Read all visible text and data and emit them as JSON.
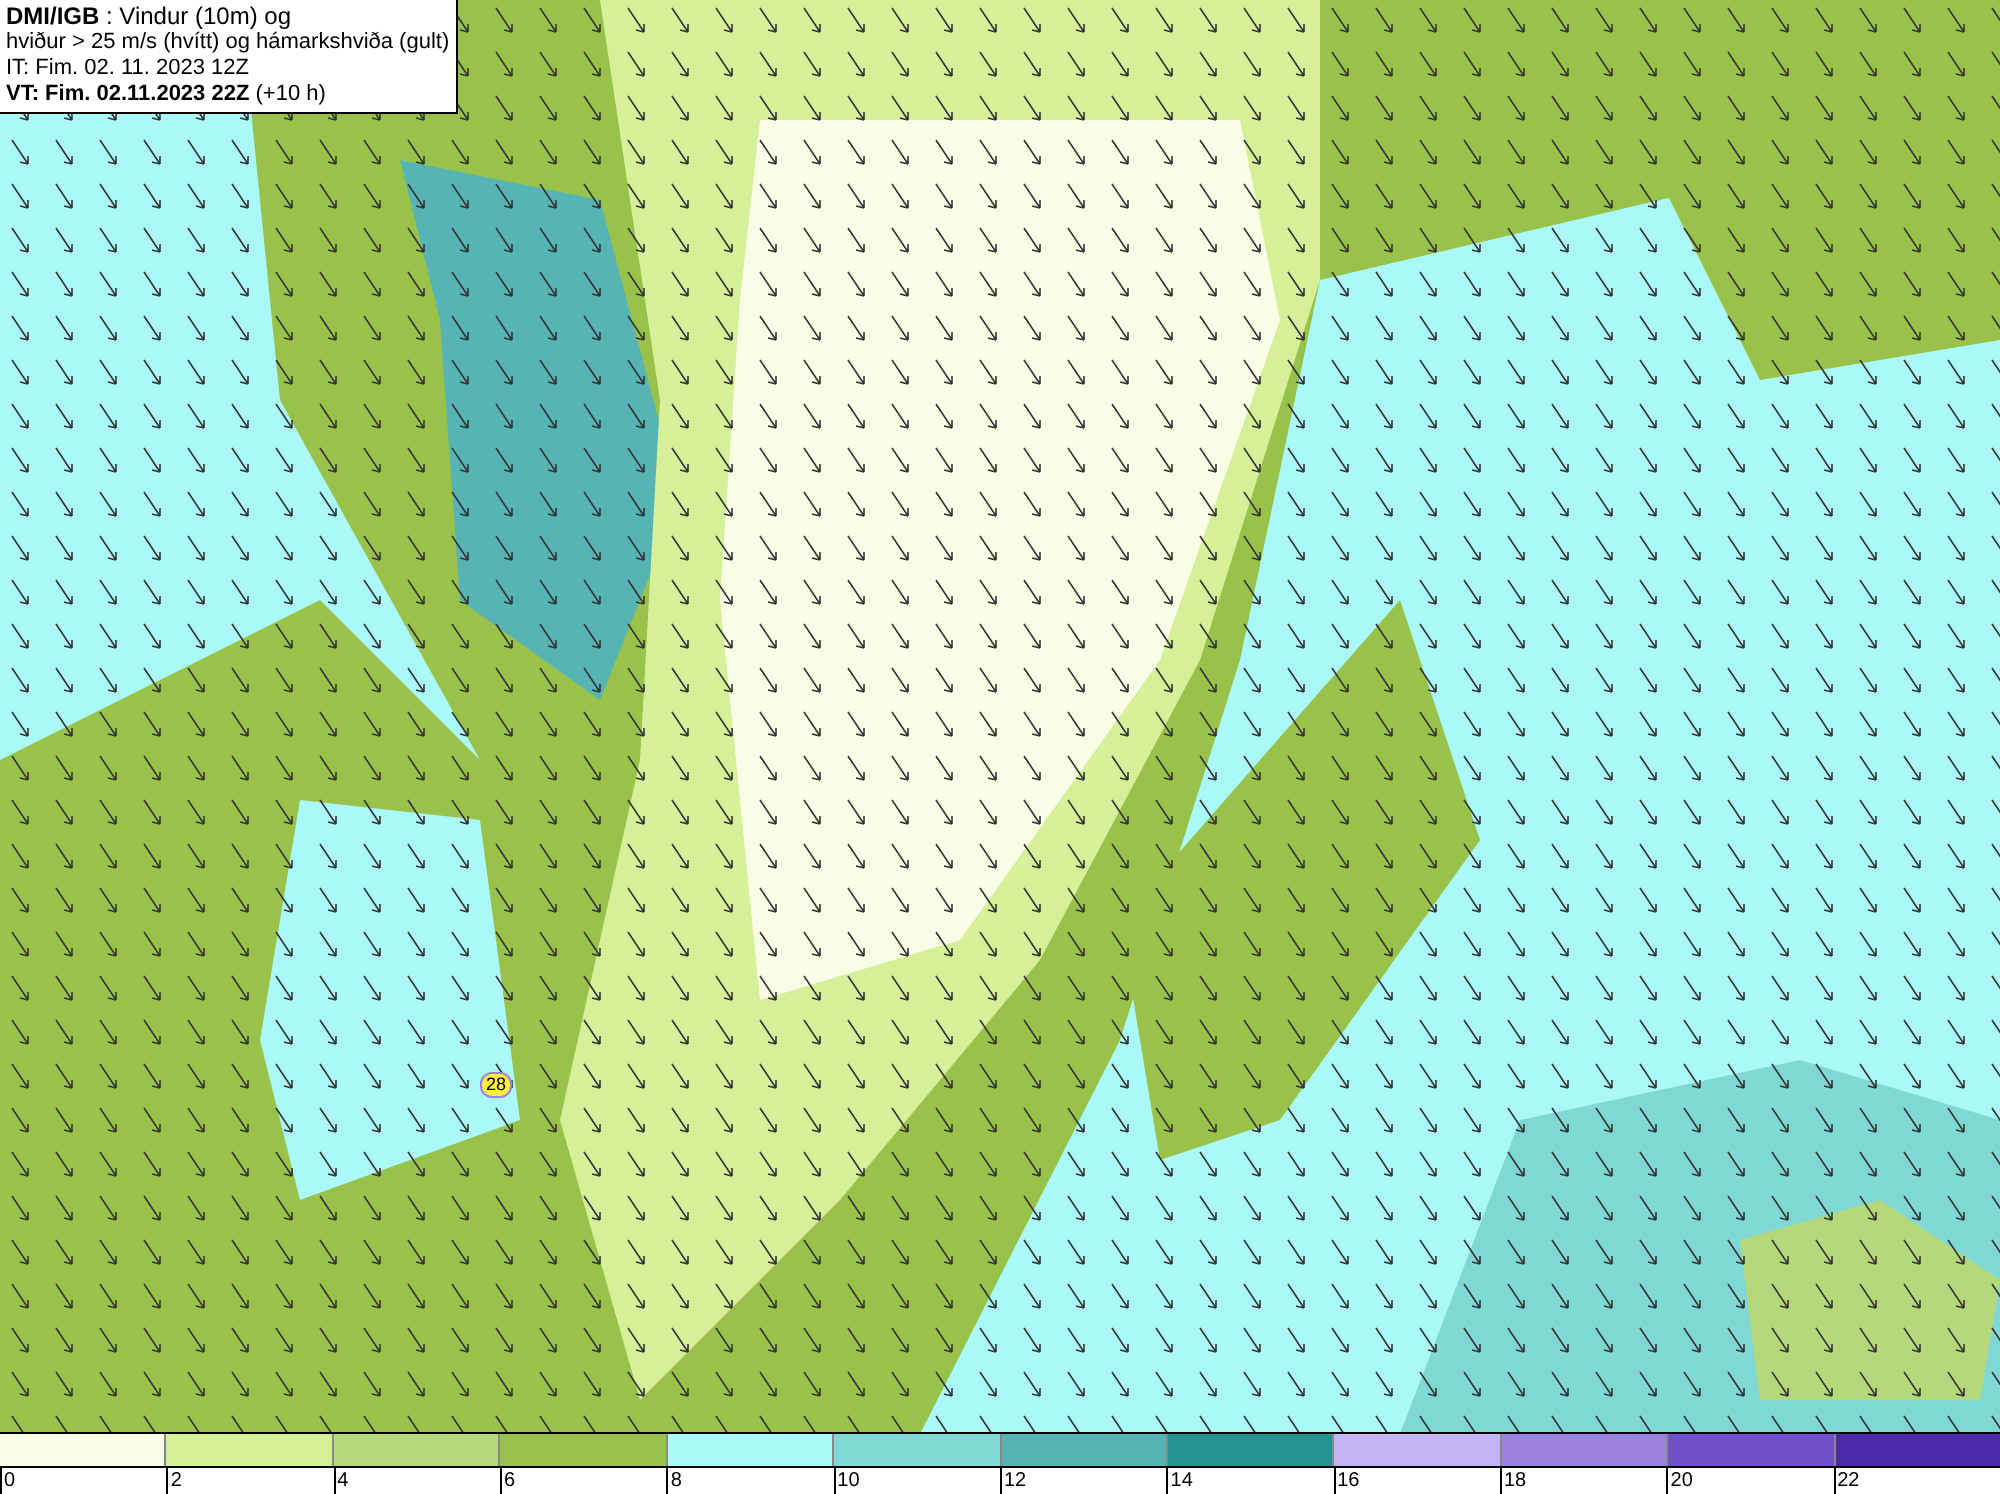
{
  "header": {
    "lines": [
      "**DMI/IGB** : Vindur (10m) og",
      "hviður > 25 m/s (hvítt) og hámarkshviða (gult)",
      "IT: Fim. 02. 11. 2023 12Z",
      "**VT: Fim. 02.11.2023 22Z** (+10 h)"
    ]
  },
  "map": {
    "gust_label": "28"
  },
  "legend": {
    "swatches": [
      {
        "color": "#fafde6"
      },
      {
        "color": "#d6f09a"
      },
      {
        "color": "#b5d97a"
      },
      {
        "color": "#98c24a"
      },
      {
        "color": "#aaf8f8"
      },
      {
        "color": "#80d8d5"
      },
      {
        "color": "#56b4b4"
      },
      {
        "color": "#259191"
      },
      {
        "color": "#c4b4f4"
      },
      {
        "color": "#9a82e0"
      },
      {
        "color": "#7050c8"
      },
      {
        "color": "#4a2aa8"
      }
    ],
    "ticks": [
      "0",
      "2",
      "4",
      "6",
      "8",
      "10",
      "12",
      "14",
      "16",
      "18",
      "20",
      "22"
    ]
  }
}
